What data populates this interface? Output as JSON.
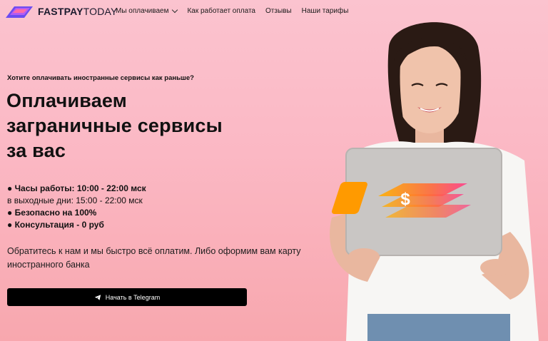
{
  "brand": {
    "name_bold": "FASTPAY",
    "name_light": "TODAY"
  },
  "nav": {
    "items": [
      {
        "label": "Мы оплачиваем",
        "has_dropdown": true
      },
      {
        "label": "Как работает оплата"
      },
      {
        "label": "Отзывы"
      },
      {
        "label": "Наши тарифы"
      }
    ]
  },
  "hero": {
    "subtitle": "Хотите оплачивать иностранные сервисы как раньше?",
    "title_lines": [
      "Оплачиваем",
      "заграничные сервисы",
      "за вас"
    ],
    "features": [
      "● Часы работы: 10:00 - 22:00 мск",
      "в выходные дни: 15:00 - 22:00 мск",
      "● Безопасно на 100%",
      "● Консультация - 0 руб"
    ],
    "description": "Обратитесь к нам и мы быстро всё оплатим. Либо оформим вам карту иностранного банка",
    "cta_label": "Начать в Telegram",
    "laptop_sticker_symbol": "$"
  },
  "colors": {
    "background_top": "#fbc3cf",
    "background_bottom": "#f8a7ae",
    "cta_bg": "#000000",
    "logo_accent": "#6c4cf0",
    "sticker_orange": "#ff8a00",
    "sticker_pink": "#ff3d8b"
  },
  "icons": [
    "logo-mark-icon",
    "chevron-down-icon",
    "telegram-icon",
    "dollar-sticker-icon"
  ]
}
